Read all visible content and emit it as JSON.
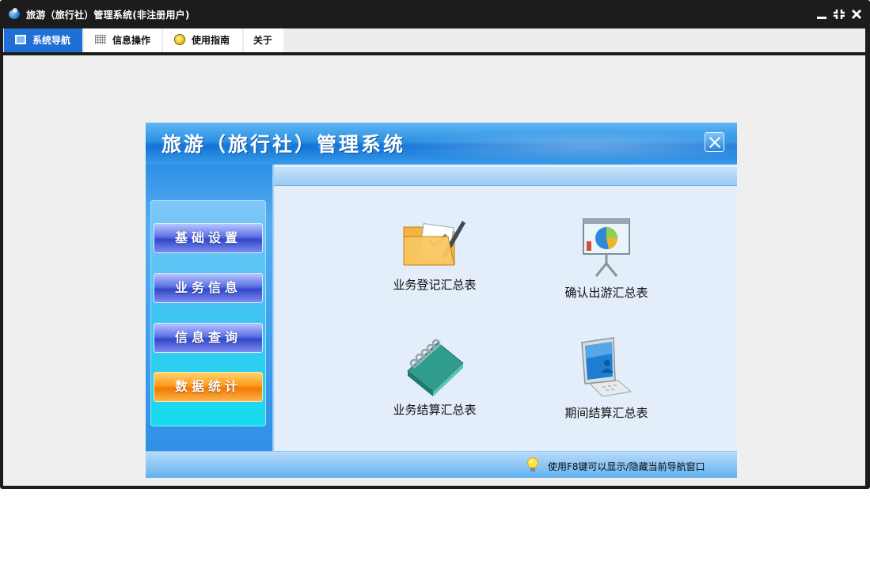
{
  "window": {
    "title": "旅游（旅行社）管理系统(非注册用户)",
    "controls": {
      "minimize": "",
      "restore": "⠿",
      "close": "✕"
    }
  },
  "menu": {
    "tabs": [
      {
        "label": "系统导航",
        "icon": "monitor-icon",
        "active": true
      },
      {
        "label": "信息操作",
        "icon": "grid-icon",
        "active": false
      },
      {
        "label": "使用指南",
        "icon": "bulb-icon",
        "active": false
      },
      {
        "label": "关于",
        "icon": "",
        "active": false
      }
    ]
  },
  "panel": {
    "title": "旅游（旅行社）管理系统",
    "sidebar": {
      "buttons": [
        {
          "label": "基础设置",
          "active": false
        },
        {
          "label": "业务信息",
          "active": false
        },
        {
          "label": "信息查询",
          "active": false
        },
        {
          "label": "数据统计",
          "active": true
        }
      ]
    },
    "tiles": [
      {
        "label": "业务登记汇总表",
        "icon": "folder-document-icon"
      },
      {
        "label": "确认出游汇总表",
        "icon": "presentation-chart-icon"
      },
      {
        "label": "业务结算汇总表",
        "icon": "notebook-icon"
      },
      {
        "label": "期间结算汇总表",
        "icon": "monitor-icon"
      }
    ],
    "status": {
      "hint": "使用F8键可以显示/隐藏当前导航窗口",
      "icon": "bulb-icon"
    }
  },
  "colors": {
    "titlebar": "#1c1c1c",
    "tab_active": "#1f6fd6",
    "panel_blue": "#2b8fe3",
    "button_blue": "#3347c8",
    "button_orange": "#f07a00"
  }
}
